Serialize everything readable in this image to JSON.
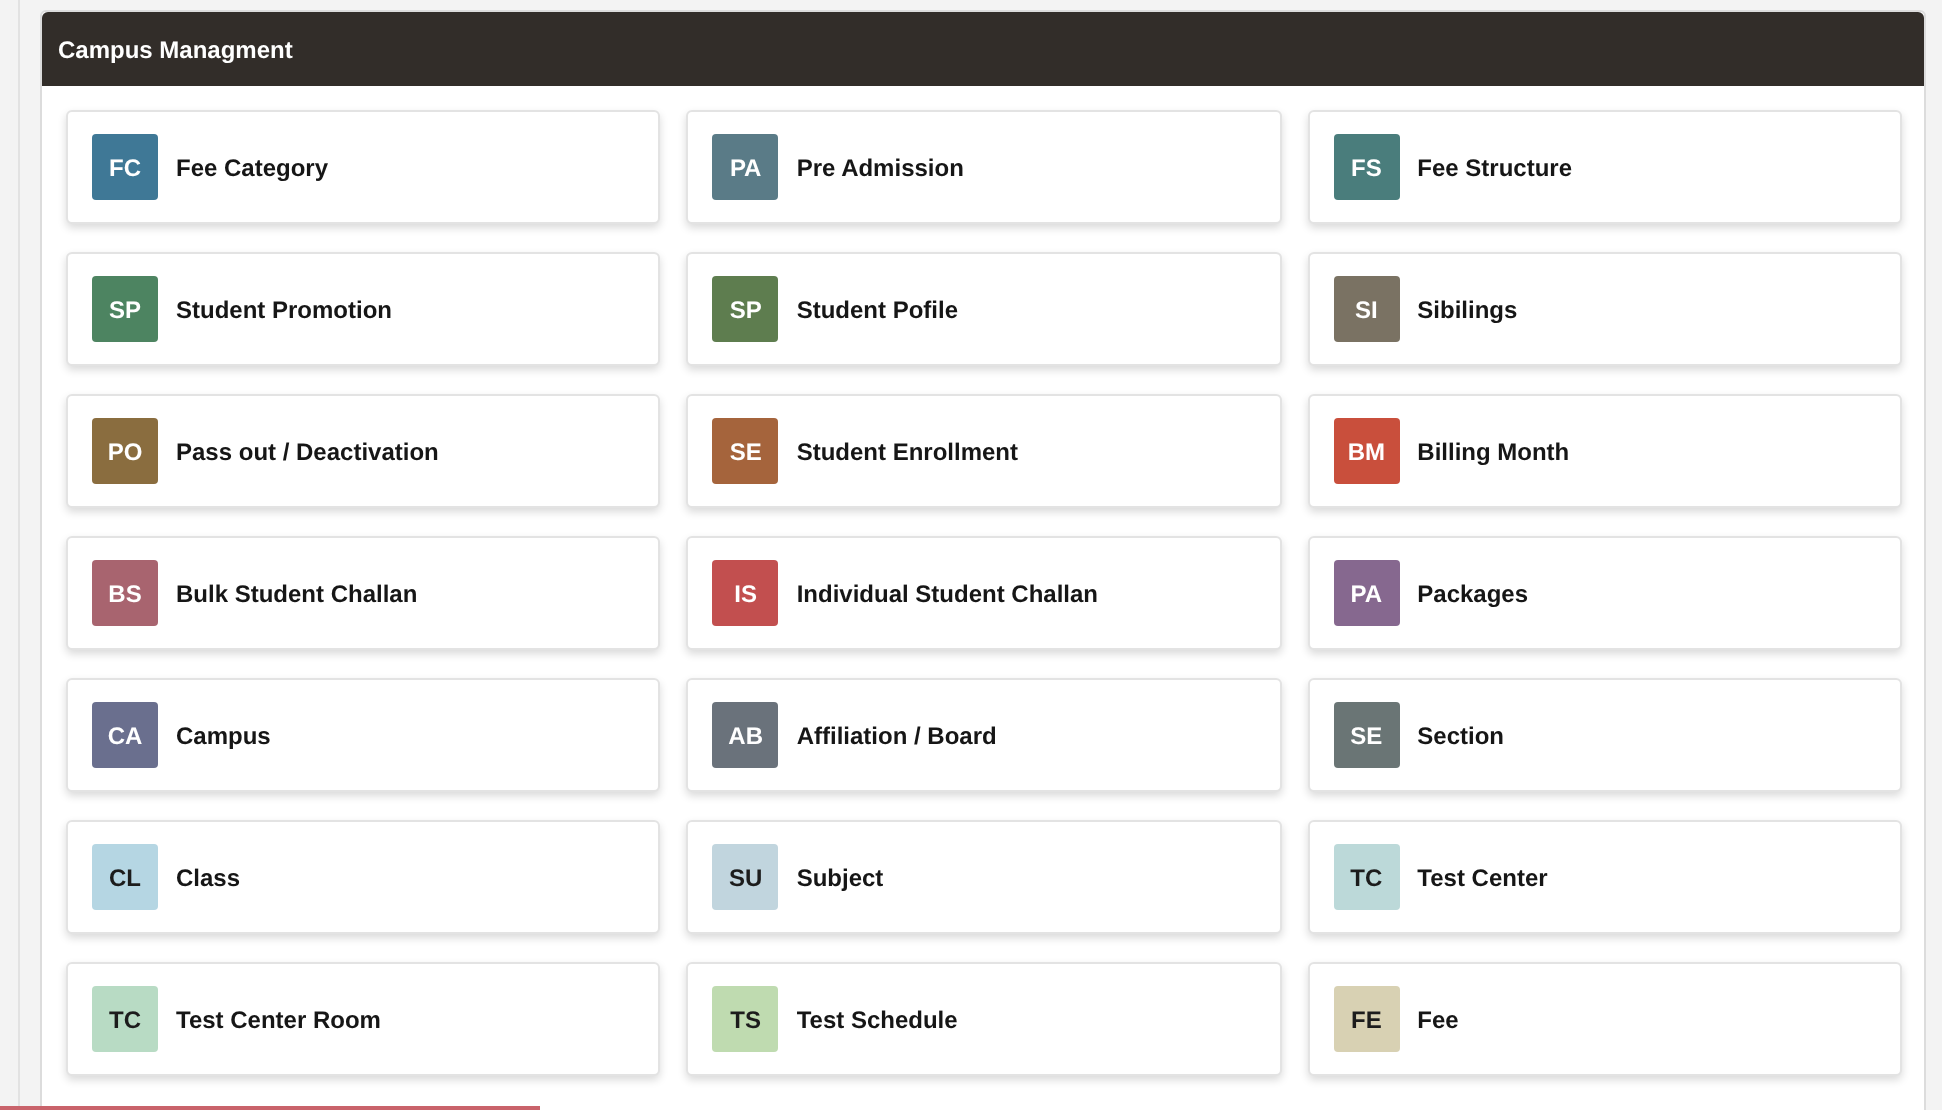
{
  "panel": {
    "title": "Campus Managment"
  },
  "tiles": [
    {
      "initials": "FC",
      "label": "Fee Category",
      "color": "#3f7896"
    },
    {
      "initials": "PA",
      "label": "Pre Admission",
      "color": "#5a7b87"
    },
    {
      "initials": "FS",
      "label": "Fee Structure",
      "color": "#4a7d7c"
    },
    {
      "initials": "SP",
      "label": "Student Promotion",
      "color": "#4d8461"
    },
    {
      "initials": "SP",
      "label": "Student Pofile",
      "color": "#5e7d4f"
    },
    {
      "initials": "SI",
      "label": "Sibilings",
      "color": "#7a7263"
    },
    {
      "initials": "PO",
      "label": "Pass out / Deactivation",
      "color": "#8a6d3f"
    },
    {
      "initials": "SE",
      "label": "Student Enrollment",
      "color": "#a5643c"
    },
    {
      "initials": "BM",
      "label": "Billing Month",
      "color": "#c94f3c"
    },
    {
      "initials": "BS",
      "label": "Bulk Student Challan",
      "color": "#a8646f"
    },
    {
      "initials": "IS",
      "label": "Individual Student Challan",
      "color": "#c24f4f"
    },
    {
      "initials": "PA",
      "label": "Packages",
      "color": "#86688f"
    },
    {
      "initials": "CA",
      "label": "Campus",
      "color": "#6a6f8e"
    },
    {
      "initials": "AB",
      "label": "Affiliation / Board",
      "color": "#6a727b"
    },
    {
      "initials": "SE",
      "label": "Section",
      "color": "#6a7575"
    },
    {
      "initials": "CL",
      "label": "Class",
      "color": "#b5d6e3"
    },
    {
      "initials": "SU",
      "label": "Subject",
      "color": "#c1d5de"
    },
    {
      "initials": "TC",
      "label": "Test Center",
      "color": "#bcd9d9"
    },
    {
      "initials": "TC",
      "label": "Test Center Room",
      "color": "#b8dbc4"
    },
    {
      "initials": "TS",
      "label": "Test Schedule",
      "color": "#bfdbb0"
    },
    {
      "initials": "FE",
      "label": "Fee",
      "color": "#d8d1b3"
    }
  ]
}
